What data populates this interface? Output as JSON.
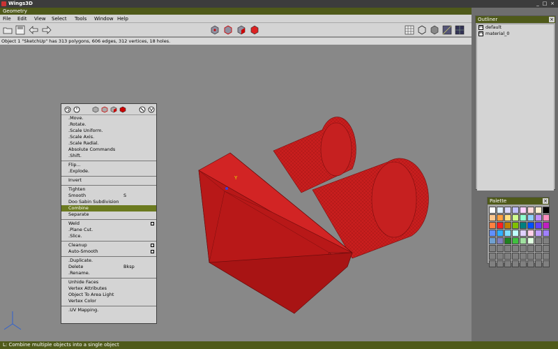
{
  "window": {
    "title": "Wings3D"
  },
  "geometry": {
    "header": "Geometry",
    "menu": [
      "File",
      "Edit",
      "View",
      "Select",
      "Tools",
      "Window",
      "Help"
    ],
    "info": "Object 1 \"SketchUp\" has 313 polygons, 606 edges, 312 vertices, 18 holes."
  },
  "context_menu": {
    "items": [
      {
        "label": ".Move."
      },
      {
        "label": ".Rotate."
      },
      {
        "label": ".Scale Uniform."
      },
      {
        "label": ".Scale Axis."
      },
      {
        "label": ".Scale Radial."
      },
      {
        "label": "Absolute Commands"
      },
      {
        "label": ".Shift."
      },
      {
        "sep": true
      },
      {
        "label": "Flip..."
      },
      {
        "label": ".Explode."
      },
      {
        "sep": true
      },
      {
        "label": "Invert"
      },
      {
        "sep": true
      },
      {
        "label": "Tighten"
      },
      {
        "label": "Smooth",
        "shortcut": "S"
      },
      {
        "label": "Doo Sabin Subdivision"
      },
      {
        "label": "Combine",
        "highlight": true
      },
      {
        "label": "Separate"
      },
      {
        "sep": true
      },
      {
        "label": "Weld",
        "option": true
      },
      {
        "label": ".Plane Cut."
      },
      {
        "label": ".Slice."
      },
      {
        "sep": true
      },
      {
        "label": "Cleanup",
        "option": true
      },
      {
        "label": "Auto-Smooth",
        "option": true
      },
      {
        "sep": true
      },
      {
        "label": ".Duplicate."
      },
      {
        "label": "Delete",
        "shortcut": "Bksp"
      },
      {
        "label": ".Rename."
      },
      {
        "sep": true
      },
      {
        "label": "Unhide Faces"
      },
      {
        "label": "Vertex Attributes"
      },
      {
        "label": "Object To Area Light"
      },
      {
        "label": "Vertex Color"
      },
      {
        "sep": true
      },
      {
        "label": ".UV Mapping."
      }
    ]
  },
  "outliner": {
    "header": "Outliner",
    "items": [
      {
        "label": "default"
      },
      {
        "label": "material_0"
      }
    ]
  },
  "palette": {
    "header": "Palette",
    "colors": [
      "#ffffff",
      "#e0f0ff",
      "#d8d8ff",
      "#c0c0ff",
      "#ffd0ff",
      "#ffd8d8",
      "#fff0d0",
      "#000000",
      "#ffc890",
      "#ffa040",
      "#ffe080",
      "#d0ff90",
      "#90ffd0",
      "#90d0ff",
      "#c090ff",
      "#ff90c0",
      "#ff8040",
      "#ff2020",
      "#c08000",
      "#80c000",
      "#008080",
      "#0050ff",
      "#6040ff",
      "#c020c0",
      "#6090ff",
      "#30b0ff",
      "#80e0ff",
      "#c0ffff",
      "#e0d0ff",
      "#ffd0e8",
      "#c0a0ff",
      "#a080ff",
      "#70a0d0",
      "#8080c0",
      "#208020",
      "#40c040",
      "#a0e0a0",
      "#e0ffe0",
      "#808080",
      "#808080",
      "#808080",
      "#808080",
      "#808080",
      "#808080",
      "#808080",
      "#808080",
      "#808080",
      "#808080",
      "#808080",
      "#808080",
      "#808080",
      "#808080",
      "#808080",
      "#808080",
      "#808080",
      "#808080",
      "#808080",
      "#808080",
      "#808080",
      "#808080",
      "#808080",
      "#808080",
      "#808080",
      "#808080"
    ]
  },
  "status": {
    "text": "L: Combine multiple objects into a single object"
  },
  "colors": {
    "accent": "#4f5a1a",
    "highlight": "#6b7a1f",
    "model": "#c81e1e"
  }
}
